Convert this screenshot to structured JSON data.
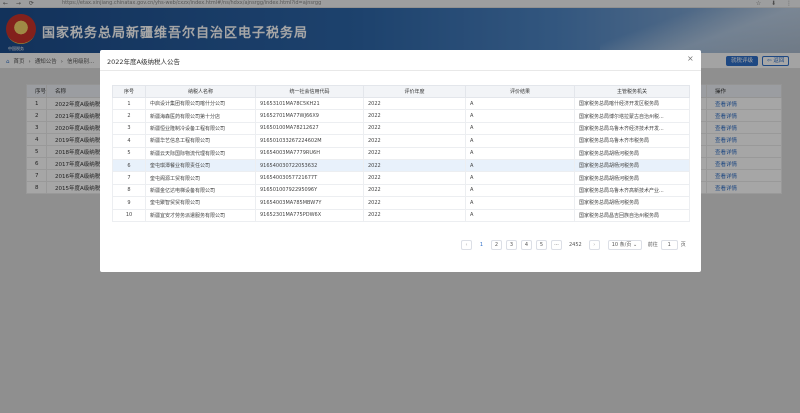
{
  "browser": {
    "nav_icons": "← → ⟳",
    "url": "https://etax.xinjiang.chinatax.gov.cn/yhs-web/cxzx/index.html#/ns/hdxx/ajnsrgg/index.html?id=ajnsrgg",
    "right_icons": "☆ ⬇ ⋮"
  },
  "site": {
    "title": "国家税务总局新疆维吾尔自治区电子税务局",
    "emblem_text": "中国税务"
  },
  "breadcrumb": {
    "home": "首页",
    "sep": "›",
    "item1": "通知公告",
    "item2": "信用级别..."
  },
  "header_buttons": {
    "blue": "就税评级",
    "back": "返回"
  },
  "background_table": {
    "headers": {
      "index": "序号",
      "name": "名称",
      "action": "操作"
    },
    "rows": [
      {
        "index": "1",
        "name": "2022年度A级纳税人..",
        "action": "查看详情"
      },
      {
        "index": "2",
        "name": "2021年度A级纳税人..",
        "action": "查看详情"
      },
      {
        "index": "3",
        "name": "2020年度A级纳税人..",
        "action": "查看详情"
      },
      {
        "index": "4",
        "name": "2019年度A级纳税人..",
        "action": "查看详情"
      },
      {
        "index": "5",
        "name": "2018年度A级纳税人..",
        "action": "查看详情"
      },
      {
        "index": "6",
        "name": "2017年度A级纳税人..",
        "action": "查看详情"
      },
      {
        "index": "7",
        "name": "2016年度A级纳税人..",
        "action": "查看详情"
      },
      {
        "index": "8",
        "name": "2015年度A级纳税人..",
        "action": "查看详情"
      }
    ]
  },
  "modal": {
    "title": "2022年度A级纳税人公告",
    "close": "×",
    "headers": {
      "index": "序号",
      "name": "纳税人名称",
      "code": "统一社会信用代码",
      "year": "评价年度",
      "result": "评价结果",
      "authority": "主管税务机关"
    },
    "rows": [
      {
        "index": "1",
        "name": "中启设计集团有限公司喀什分公司",
        "code": "91653101MA78C5KH21",
        "year": "2022",
        "result": "A",
        "authority": "国家税务总局喀什经济开发区税务局"
      },
      {
        "index": "2",
        "name": "新疆海森医药有限公司第十分店",
        "code": "91652701MA77WJ66X9",
        "year": "2022",
        "result": "A",
        "authority": "国家税务总局博尔塔拉蒙古自治州税..."
      },
      {
        "index": "3",
        "name": "新疆恒业隆制冷设备工程有限公司",
        "code": "91650100MA78212627",
        "year": "2022",
        "result": "A",
        "authority": "国家税务总局乌鲁木齐经济技术开发..."
      },
      {
        "index": "4",
        "name": "新疆华艺信息工程有限公司",
        "code": "916501033267224602M",
        "year": "2022",
        "result": "A",
        "authority": "国家税务总局乌鲁木齐市税务局"
      },
      {
        "index": "5",
        "name": "新疆云天际国际物流代理有限公司",
        "code": "91654003MA7779RU6H",
        "year": "2022",
        "result": "A",
        "authority": "国家税务总局胡杨河税务局"
      },
      {
        "index": "6",
        "name": "奎屯琪潭餐业有限责任公司",
        "code": "916540030722053632",
        "year": "2022",
        "result": "A",
        "authority": "国家税务总局胡杨河税务局"
      },
      {
        "index": "7",
        "name": "奎屯阁源工贸有限公司",
        "code": "91654003057721677T",
        "year": "2022",
        "result": "A",
        "authority": "国家税务总局胡杨河税务局"
      },
      {
        "index": "8",
        "name": "新疆金亿达电梯设备有限公司",
        "code": "91650100792295096Y",
        "year": "2022",
        "result": "A",
        "authority": "国家税务总局乌鲁木齐高新技术产业..."
      },
      {
        "index": "9",
        "name": "奎屯聚智贸贸有限公司",
        "code": "91654003MA785MBW7Y",
        "year": "2022",
        "result": "A",
        "authority": "国家税务总局胡杨河税务局"
      },
      {
        "index": "10",
        "name": "新疆宜安才劳务派遣服务有限公司",
        "code": "91652301MA775PDW6X",
        "year": "2022",
        "result": "A",
        "authority": "国家税务总局昌吉回族自治州税务局"
      }
    ],
    "pagination": {
      "prev": "‹",
      "pages": [
        "1",
        "2",
        "3",
        "4",
        "5"
      ],
      "ellipsis": "···",
      "last": "2452",
      "next": "›",
      "page_size": "10 条/页 ⌄",
      "jump_label": "前往",
      "jump_value": "1",
      "jump_suffix": "页"
    }
  },
  "colors": {
    "accent": "#2f6fc8",
    "header_start": "#1d4d8c",
    "highlight_row": "#e8f1fb"
  }
}
